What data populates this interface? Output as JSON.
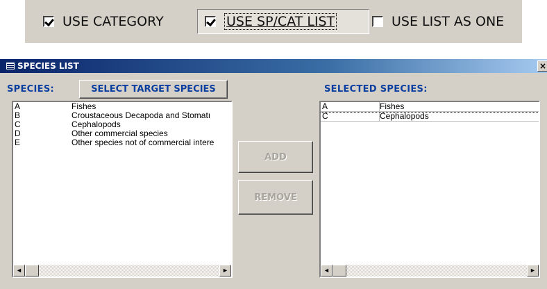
{
  "toolbar": {
    "use_category": {
      "label": "USE CATEGORY",
      "checked": true
    },
    "use_sp_cat_list": {
      "label": "USE SP/CAT LIST",
      "checked": true
    },
    "use_list_as_one": {
      "label": "USE LIST AS ONE",
      "checked": false
    }
  },
  "window": {
    "title": "SPECIES LIST",
    "close_symbol": "×"
  },
  "species": {
    "label": "SPECIES:",
    "select_button": "SELECT TARGET SPECIES",
    "items": [
      {
        "code": "A",
        "name": "Fishes"
      },
      {
        "code": "B",
        "name": "Croustaceous Decapoda and Stomatı"
      },
      {
        "code": "C",
        "name": "Cephalopods"
      },
      {
        "code": "D",
        "name": "Other commercial species"
      },
      {
        "code": "E",
        "name": "Other species not of commercial intere"
      }
    ]
  },
  "actions": {
    "add": "ADD",
    "remove": "REMOVE"
  },
  "selected": {
    "label": "SELECTED SPECIES:",
    "items": [
      {
        "code": "A",
        "name": "Fishes"
      },
      {
        "code": "C",
        "name": "Cephalopods"
      }
    ]
  },
  "scroll": {
    "left_arrow": "◄",
    "right_arrow": "►"
  }
}
